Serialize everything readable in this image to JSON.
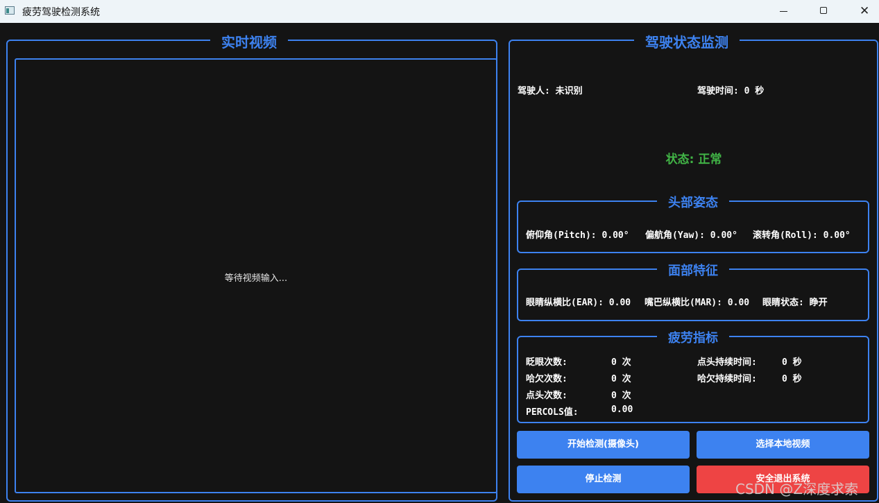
{
  "window": {
    "title": "疲劳驾驶检测系统",
    "controls": {
      "minimize": "—",
      "maximize": "☐",
      "close": "✕"
    }
  },
  "video_panel": {
    "title": "实时视频",
    "placeholder": "等待视频输入..."
  },
  "monitor_panel": {
    "title": "驾驶状态监测",
    "driver": "驾驶人: 未识别",
    "drive_time": "驾驶时间: 0 秒",
    "status": "状态: 正常",
    "status_color": "#41b446"
  },
  "head_pose": {
    "title": "头部姿态",
    "pitch": "俯仰角(Pitch): 0.00°",
    "yaw": "偏航角(Yaw): 0.00°",
    "roll": "滚转角(Roll): 0.00°"
  },
  "face_features": {
    "title": "面部特征",
    "ear": "眼睛纵横比(EAR): 0.00",
    "mar": "嘴巴纵横比(MAR): 0.00",
    "eye_state": "眼睛状态: 睁开"
  },
  "fatigue": {
    "title": "疲劳指标",
    "blink_label": "眨眼次数:",
    "blink_value": "0 次",
    "yawn_label": "哈欠次数:",
    "yawn_value": "0 次",
    "nod_label": "点头次数:",
    "nod_value": "0 次",
    "perclos_label": "PERCOLS值:",
    "perclos_value": "0.00",
    "nod_duration_label": "点头持续时间:",
    "nod_duration_value": "0 秒",
    "yawn_duration_label": "哈欠持续时间:",
    "yawn_duration_value": "0 秒"
  },
  "buttons": {
    "start_camera": "开始检测(摄像头)",
    "select_video": "选择本地视频",
    "stop": "停止检测",
    "exit": "安全退出系统"
  },
  "watermark": "CSDN @Z深度求索",
  "colors": {
    "accent": "#3d82f0",
    "danger": "#ee4444",
    "background": "#141414"
  }
}
